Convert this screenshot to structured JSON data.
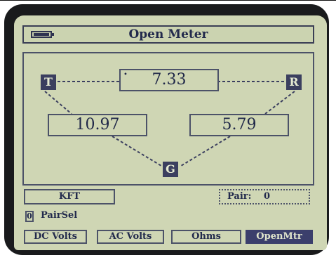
{
  "header": {
    "title": "Open Meter",
    "battery_icon": "battery-full-icon"
  },
  "terminals": {
    "t": "T",
    "r": "R",
    "g": "G"
  },
  "readings": {
    "t_to_r": "7.33",
    "t_to_g": "10.97",
    "r_to_g": "5.79"
  },
  "status": {
    "units": "KFT",
    "pair_label": "Pair:",
    "pair_value": "0"
  },
  "pairsel": {
    "value": "0",
    "label": "PairSel"
  },
  "softkeys": [
    {
      "label": "DC Volts",
      "active": false
    },
    {
      "label": "AC Volts",
      "active": false
    },
    {
      "label": "Ohms",
      "active": false
    },
    {
      "label": "OpenMtr",
      "active": true
    }
  ],
  "colors": {
    "screen_background": "#cfd6b4",
    "active_softkey": "#3b3f6c",
    "bezel": "#191a1c"
  }
}
